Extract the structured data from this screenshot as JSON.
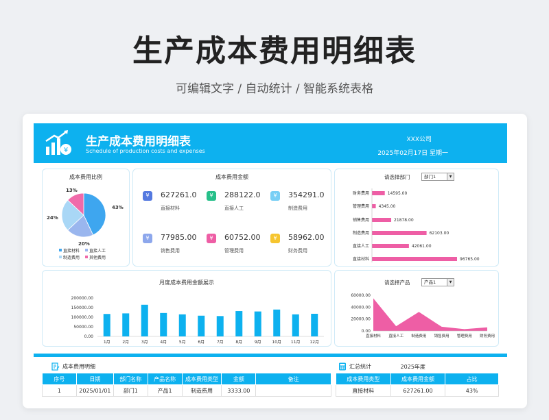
{
  "page": {
    "title": "生产成本费用明细表",
    "subtitle": "可编辑文字 / 自动统计 / 智能系统表格"
  },
  "banner": {
    "title": "生产成本费用明细表",
    "subtitle": "Schedule of production costs and expenses",
    "company": "XXX公司",
    "date": "2025年02月17日  星期一"
  },
  "pie": {
    "title": "成本费用比例",
    "labels": [
      "43%",
      "20%",
      "24%",
      "13%"
    ],
    "legend": [
      "直接材料",
      "直接人工",
      "制造费用",
      "其他费用"
    ],
    "colors": [
      "#3ea6ef",
      "#9ab6ee",
      "#a9d7f6",
      "#f06aaa"
    ],
    "values": [
      43,
      20,
      24,
      13
    ]
  },
  "stats": {
    "title": "成本费用金额",
    "items": [
      {
        "value": "627261.0",
        "label": "直接材料",
        "icon": "yen-icon",
        "color": "#5479e0"
      },
      {
        "value": "288122.0",
        "label": "直接人工",
        "icon": "yen-icon",
        "color": "#27c08a"
      },
      {
        "value": "354291.0",
        "label": "制造费用",
        "icon": "yen-icon",
        "color": "#78cff5"
      },
      {
        "value": "77985.00",
        "label": "销售费用",
        "icon": "yen-icon",
        "color": "#8da7ec"
      },
      {
        "value": "60752.00",
        "label": "管理费用",
        "icon": "yen-icon",
        "color": "#ee5ea5"
      },
      {
        "value": "58962.00",
        "label": "财务费用",
        "icon": "yen-icon",
        "color": "#f6c52f"
      }
    ]
  },
  "dept": {
    "label": "请选择部门",
    "selected": "部门1",
    "bar_color": "#ee5ea5"
  },
  "product": {
    "label": "请选择产品",
    "selected": "产品1",
    "area_color": "#ee5ea5"
  },
  "month": {
    "title": "月度成本费用金额展示",
    "bar_color": "#0db1ef"
  },
  "chart_data": [
    {
      "type": "pie",
      "categories": [
        "直接材料",
        "直接人工",
        "制造费用",
        "其他费用"
      ],
      "values": [
        43,
        20,
        24,
        13
      ]
    },
    {
      "type": "bar",
      "orientation": "horizontal",
      "categories": [
        "财务费用",
        "管理费用",
        "销售费用",
        "制造费用",
        "直接人工",
        "直接材料"
      ],
      "values": [
        14595.0,
        4345.0,
        21878.0,
        62103.0,
        42061.0,
        96765.0
      ],
      "value_labels": [
        "14595.00",
        "4345.00",
        "21878.00",
        "62103.00",
        "42061.00",
        "96765.00"
      ]
    },
    {
      "type": "bar",
      "categories": [
        "1月",
        "2月",
        "3月",
        "4月",
        "5月",
        "6月",
        "7月",
        "8月",
        "9月",
        "10月",
        "11月",
        "12月"
      ],
      "values": [
        117000,
        120000,
        165000,
        122000,
        115000,
        108000,
        106000,
        132000,
        130000,
        140000,
        115000,
        118000
      ],
      "yticks": [
        "200000.00",
        "150000.00",
        "100000.00",
        "50000.00",
        "0.00"
      ],
      "ylim": [
        0,
        200000
      ]
    },
    {
      "type": "area",
      "categories": [
        "直接材料",
        "直接人工",
        "制造费用",
        "销售费用",
        "管理费用",
        "财务费用"
      ],
      "values": [
        55000,
        8000,
        32000,
        7000,
        3000,
        6000
      ],
      "yticks": [
        "60000.00",
        "40000.00",
        "20000.00",
        "0.00"
      ],
      "ylim": [
        0,
        60000
      ]
    }
  ],
  "detail": {
    "section_title": "成本费用明细",
    "headers": [
      "序号",
      "日期",
      "部门名称",
      "产品名称",
      "成本费用类型",
      "金额",
      "备注"
    ],
    "rows": [
      [
        "1",
        "2025/01/01",
        "部门1",
        "产品1",
        "制造费用",
        "3333.00",
        ""
      ]
    ]
  },
  "summary": {
    "section_title": "汇总统计",
    "year": "2025年度",
    "headers": [
      "成本费用类型",
      "成本费用金额",
      "占比"
    ],
    "rows": [
      [
        "直接材料",
        "627261.00",
        "43%"
      ]
    ]
  }
}
